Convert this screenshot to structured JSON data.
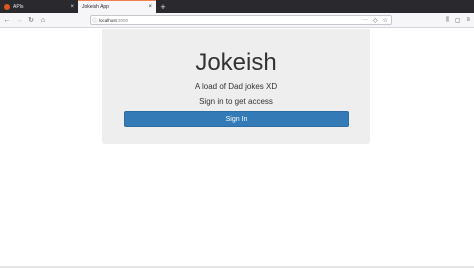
{
  "browser": {
    "tabs": [
      {
        "label": "APIs",
        "active": false
      },
      {
        "label": "Jokeish App",
        "active": true
      }
    ],
    "tab_close_glyph": "×",
    "new_tab_glyph": "+",
    "url": {
      "host": "localhost",
      "port": ":3000"
    },
    "nav_glyphs": {
      "back": "←",
      "forward": "→",
      "reload": "↻",
      "home": "⌂"
    },
    "url_glyphs": {
      "info": "ⓘ",
      "more": "···",
      "pocket": "◇",
      "bookmark": "☆"
    },
    "toolbar_glyphs": {
      "library": "⫼",
      "sidebar": "▢",
      "menu": "≡"
    }
  },
  "page": {
    "title": "Jokeish",
    "subtitle": "A load of Dad jokes XD",
    "signin_prompt": "Sign in to get access",
    "signin_button": "Sign In"
  },
  "colors": {
    "primary_button": "#337ab7",
    "jumbotron_bg": "#eeeeee",
    "tabstrip_bg": "#2a2a2e"
  }
}
